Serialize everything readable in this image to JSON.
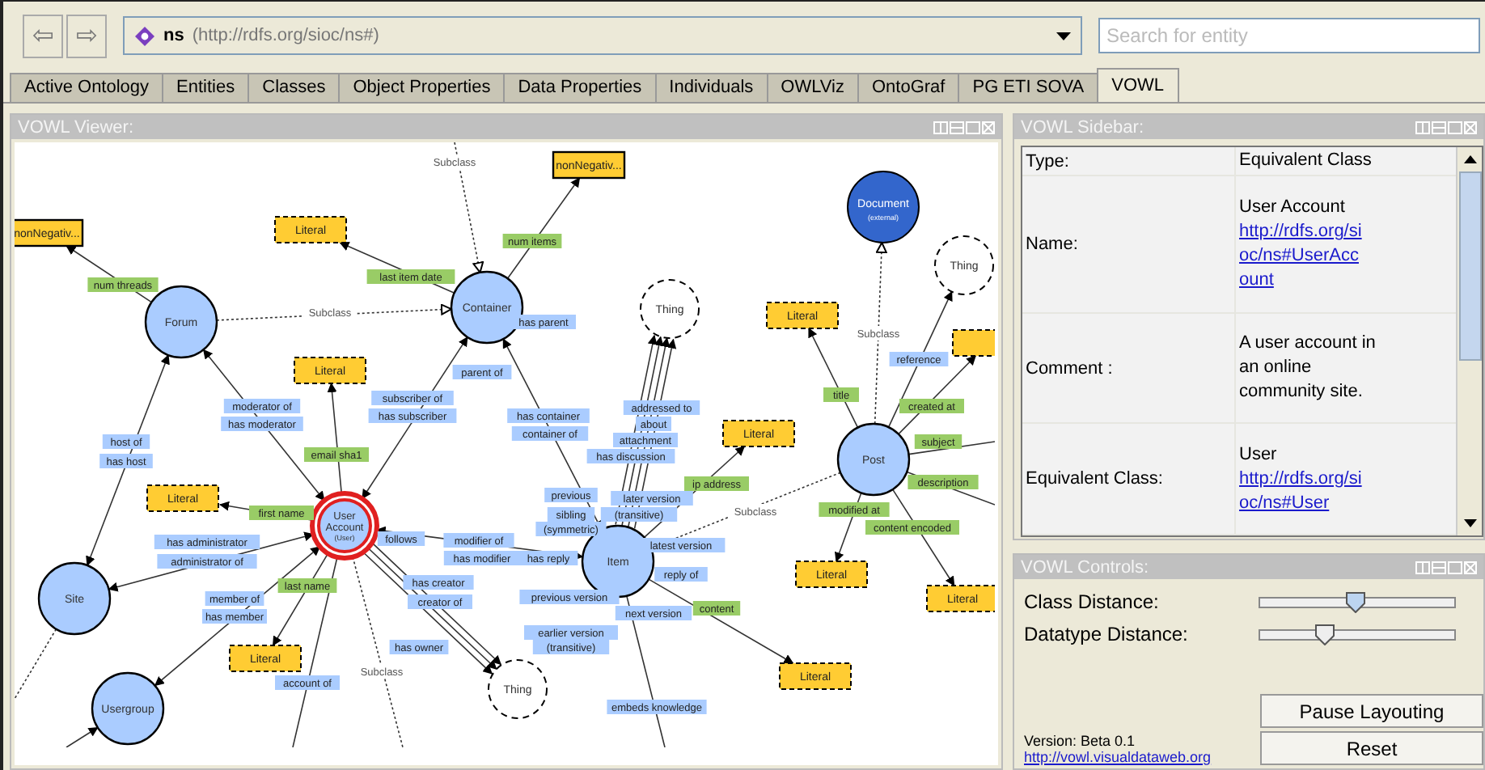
{
  "toolbar": {
    "back_symbol": "⇦",
    "forward_symbol": "⇨",
    "ontology": {
      "name": "ns",
      "iri": "(http://rdfs.org/sioc/ns#)"
    },
    "search": {
      "placeholder": "Search for entity"
    }
  },
  "tabs": [
    {
      "label": "Active Ontology",
      "selected": false
    },
    {
      "label": "Entities",
      "selected": false
    },
    {
      "label": "Classes",
      "selected": false
    },
    {
      "label": "Object Properties",
      "selected": false
    },
    {
      "label": "Data Properties",
      "selected": false
    },
    {
      "label": "Individuals",
      "selected": false
    },
    {
      "label": "OWLViz",
      "selected": false
    },
    {
      "label": "OntoGraf",
      "selected": false
    },
    {
      "label": "PG ETI SOVA",
      "selected": false
    },
    {
      "label": "VOWL",
      "selected": true
    }
  ],
  "viewer": {
    "title": "VOWL Viewer:",
    "nodes": [
      {
        "kind": "datatype",
        "label": "nonNegativ..."
      },
      {
        "kind": "literal",
        "label": "Literal"
      },
      {
        "kind": "class",
        "label": "Forum"
      },
      {
        "kind": "class",
        "label": "Container"
      },
      {
        "kind": "literal",
        "label": "Literal"
      },
      {
        "kind": "thing",
        "label": "Thing"
      },
      {
        "kind": "datatype",
        "label": "nonNegativ..."
      },
      {
        "kind": "external",
        "label": "Document",
        "note": "(external)"
      },
      {
        "kind": "thing",
        "label": "Thing"
      },
      {
        "kind": "literal",
        "label": "Literal"
      },
      {
        "kind": "literal"
      },
      {
        "kind": "literal",
        "label": "Literal"
      },
      {
        "kind": "class",
        "label": "Post"
      },
      {
        "kind": "literal",
        "label": "Literal"
      },
      {
        "kind": "equivalent",
        "label": "User",
        "label2": "Account",
        "note": "(User)"
      },
      {
        "kind": "class",
        "label": "Item"
      },
      {
        "kind": "class",
        "label": "Site"
      },
      {
        "kind": "literal",
        "label": "Literal"
      },
      {
        "kind": "literal",
        "label": "Literal"
      },
      {
        "kind": "literal",
        "label": "Literal"
      },
      {
        "kind": "literal",
        "label": "Literal"
      },
      {
        "kind": "thing",
        "label": "Thing"
      },
      {
        "kind": "class",
        "label": "Usergroup"
      }
    ],
    "edge_labels": [
      {
        "kind": "subclass",
        "text": "Subclass"
      },
      {
        "kind": "datatype",
        "text": "num items"
      },
      {
        "kind": "datatype",
        "text": "num threads"
      },
      {
        "kind": "datatype",
        "text": "last item date"
      },
      {
        "kind": "subclass",
        "text": "Subclass"
      },
      {
        "kind": "object",
        "text": "has parent"
      },
      {
        "kind": "subclass",
        "text": "Subclass"
      },
      {
        "kind": "object",
        "text": "parent of"
      },
      {
        "kind": "object",
        "text": "reference"
      },
      {
        "kind": "object",
        "text": "moderator of"
      },
      {
        "kind": "object",
        "text": "subscriber of"
      },
      {
        "kind": "object",
        "text": "addressed to"
      },
      {
        "kind": "datatype",
        "text": "title"
      },
      {
        "kind": "datatype",
        "text": "created at"
      },
      {
        "kind": "object",
        "text": "has moderator"
      },
      {
        "kind": "object",
        "text": "has subscriber"
      },
      {
        "kind": "object",
        "text": "has container"
      },
      {
        "kind": "object",
        "text": "about"
      },
      {
        "kind": "object",
        "text": "host of"
      },
      {
        "kind": "object",
        "text": "container of"
      },
      {
        "kind": "object",
        "text": "attachment"
      },
      {
        "kind": "datatype",
        "text": "subject"
      },
      {
        "kind": "object",
        "text": "has host"
      },
      {
        "kind": "datatype",
        "text": "email sha1"
      },
      {
        "kind": "object",
        "text": "has discussion"
      },
      {
        "kind": "object",
        "text": "previous"
      },
      {
        "kind": "datatype",
        "text": "ip address"
      },
      {
        "kind": "datatype",
        "text": "description"
      },
      {
        "kind": "datatype",
        "text": "first name"
      },
      {
        "kind": "object",
        "text": "later version"
      },
      {
        "kind": "object",
        "text": "sibling"
      },
      {
        "kind": "object",
        "text": "(transitive)"
      },
      {
        "kind": "subclass",
        "text": "Subclass"
      },
      {
        "kind": "datatype",
        "text": "modified at"
      },
      {
        "kind": "object",
        "text": "follows"
      },
      {
        "kind": "object",
        "text": "modifier of"
      },
      {
        "kind": "object",
        "text": "(symmetric)"
      },
      {
        "kind": "datatype",
        "text": "content encoded"
      },
      {
        "kind": "object",
        "text": "has administrator"
      },
      {
        "kind": "object",
        "text": "latest version"
      },
      {
        "kind": "object",
        "text": "administrator of"
      },
      {
        "kind": "object",
        "text": "has modifier"
      },
      {
        "kind": "object",
        "text": "has reply"
      },
      {
        "kind": "datatype",
        "text": "last name"
      },
      {
        "kind": "object",
        "text": "has creator"
      },
      {
        "kind": "object",
        "text": "reply of"
      },
      {
        "kind": "object",
        "text": "member of"
      },
      {
        "kind": "object",
        "text": "creator of"
      },
      {
        "kind": "object",
        "text": "previous version"
      },
      {
        "kind": "datatype",
        "text": "content"
      },
      {
        "kind": "object",
        "text": "has member"
      },
      {
        "kind": "object",
        "text": "next version"
      },
      {
        "kind": "object",
        "text": "earlier version"
      },
      {
        "kind": "object",
        "text": "has owner"
      },
      {
        "kind": "object",
        "text": "(transitive)"
      },
      {
        "kind": "subclass",
        "text": "Subclass"
      },
      {
        "kind": "object",
        "text": "account of"
      },
      {
        "kind": "object",
        "text": "embeds knowledge"
      }
    ]
  },
  "sidebar": {
    "title": "VOWL Sidebar:",
    "rows": [
      {
        "label": "Type:",
        "text": "Equivalent Class"
      },
      {
        "label": "Name:",
        "text": "User Account",
        "link": "http://rdfs.org/sioc/ns#UserAccount"
      },
      {
        "label": "Comment :",
        "text": "A user account in an online community site."
      },
      {
        "label": "Equivalent Class:",
        "text": "User",
        "link": "http://rdfs.org/sioc/ns#User"
      }
    ]
  },
  "controls": {
    "title": "VOWL Controls:",
    "sliders": [
      {
        "label": "Class Distance:",
        "level": 0.49
      },
      {
        "label": "Datatype Distance:",
        "level": 0.33
      }
    ],
    "buttons": [
      "Pause Layouting",
      "Reset"
    ],
    "version": "Version: Beta 0.1",
    "link": "http://vowl.visualdataweb.org"
  }
}
